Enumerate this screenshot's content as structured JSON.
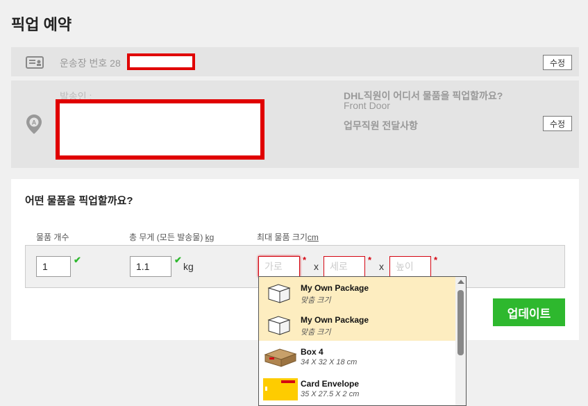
{
  "page": {
    "title": "픽업 예약"
  },
  "tracking": {
    "label": "운송장 번호 28",
    "edit_label": "수정"
  },
  "address": {
    "sender_label": "발송인 :",
    "where_title": "DHL직원이 어디서 물품을 픽업할까요?",
    "where_value": "Front Door",
    "memo_label": "업무직원 전달사항",
    "edit_label": "수정"
  },
  "pickup": {
    "title": "어떤 물품을 픽업할까요?",
    "count_label": "물품 개수",
    "weight_label": "총 무게 (모든 발송물)",
    "weight_unit_label": "kg",
    "size_label": "최대 물품 크기",
    "size_unit_label": "cm",
    "count_value": "1",
    "weight_value": "1.1",
    "weight_unit": "kg",
    "length_placeholder": "가로",
    "width_placeholder": "세로",
    "height_placeholder": "높이",
    "times": "x",
    "required_mark": "*",
    "check_mark": "✔",
    "update_label": "업데이트"
  },
  "package_options": [
    {
      "name": "My Own Package",
      "size": "맞춤 크기",
      "thumb": "white-box-icon"
    },
    {
      "name": "My Own Package",
      "size": "맞춤 크기",
      "thumb": "white-box-icon"
    },
    {
      "name": "Box 4",
      "size": "34 X 32 X 18 cm",
      "thumb": "dhl-box-icon"
    },
    {
      "name": "Card Envelope",
      "size": "35 X 27.5 X 2 cm",
      "thumb": "dhl-envelope-icon"
    }
  ],
  "colors": {
    "accent_red": "#d40511",
    "update_green": "#2eb82e",
    "highlight": "#fdedc0"
  }
}
